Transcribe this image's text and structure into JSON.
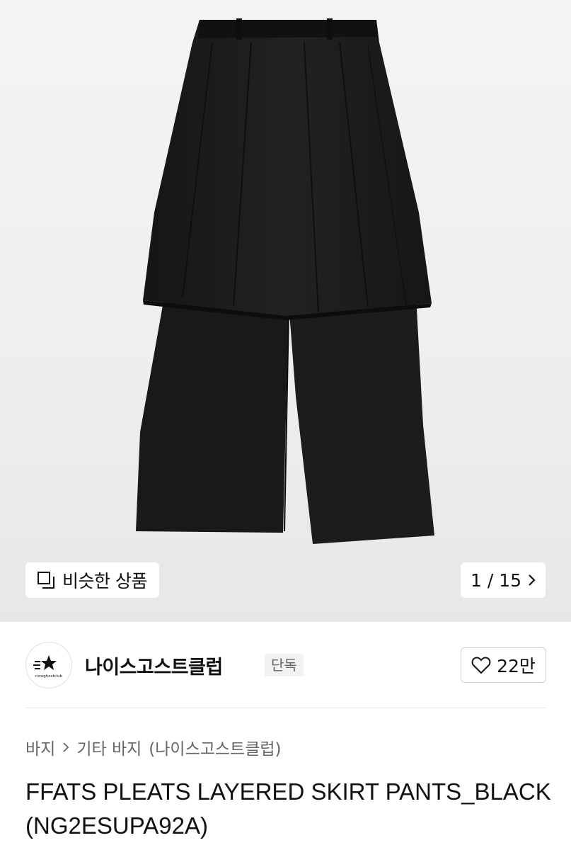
{
  "gallery": {
    "similar_label": "비슷한 상품",
    "similar_icon": "similar-products-icon",
    "pager_text": "1 / 15",
    "pager_icon": "chevron-right-icon",
    "garment_color": "#1b1b1b",
    "background_color": "#f0f0f1"
  },
  "brand": {
    "name": "나이스고스트클럽",
    "badge": "단독",
    "logo_text": "niceghostclub",
    "like_count": "22만",
    "like_icon": "heart-outline-icon"
  },
  "breadcrumb": {
    "category": "바지",
    "separator_icon": "chevron-right-icon",
    "subcategory": "기타 바지",
    "brand_suffix": "(나이스고스트클럽)"
  },
  "product": {
    "title": "FFATS PLEATS LAYERED SKIRT PANTS_BLACK(NG2ESUPA92A)"
  }
}
